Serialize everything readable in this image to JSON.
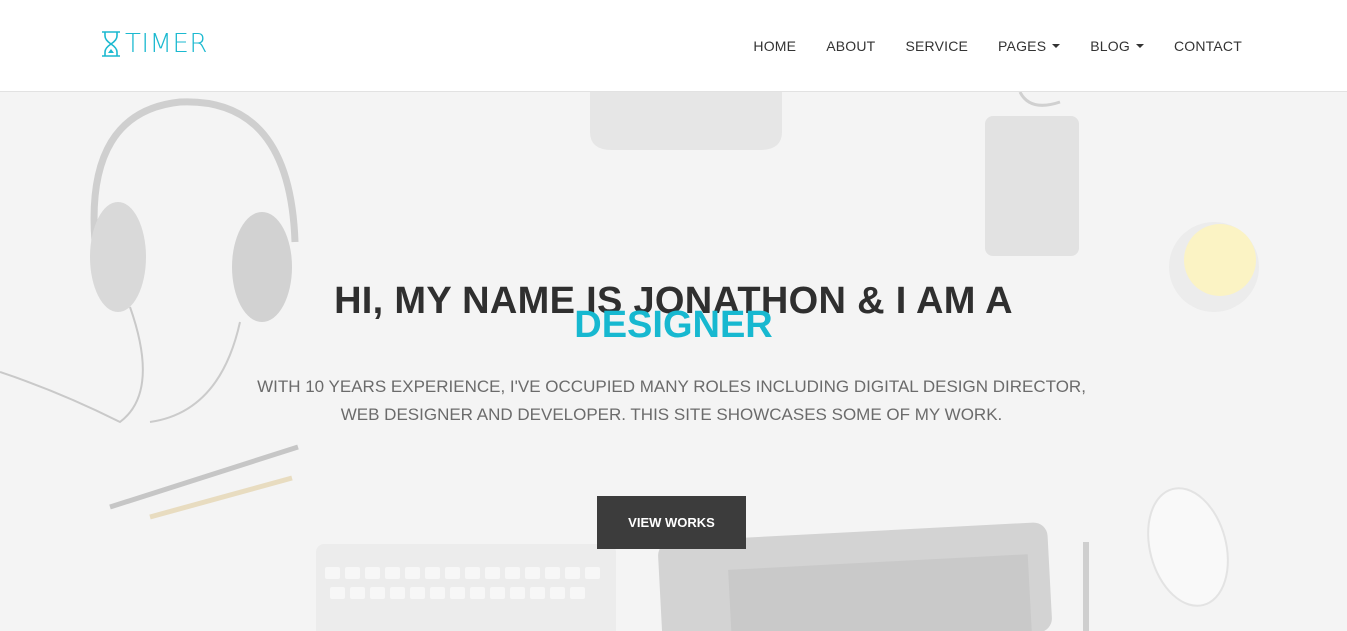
{
  "brand": {
    "name": "TIMER",
    "color": "#1bb9d0"
  },
  "nav": {
    "items": [
      {
        "label": "HOME",
        "has_dropdown": false
      },
      {
        "label": "ABOUT",
        "has_dropdown": false
      },
      {
        "label": "SERVICE",
        "has_dropdown": false
      },
      {
        "label": "PAGES",
        "has_dropdown": true
      },
      {
        "label": "BLOG",
        "has_dropdown": true
      },
      {
        "label": "CONTACT",
        "has_dropdown": false
      }
    ]
  },
  "hero": {
    "title": "HI, MY NAME IS JONATHON & I AM A",
    "highlight": "DESIGNER",
    "description_line1": "WITH 10 YEARS EXPERIENCE, I'VE OCCUPIED MANY ROLES INCLUDING DIGITAL DESIGN DIRECTOR,",
    "description_line2": "WEB DESIGNER AND DEVELOPER. THIS SITE SHOWCASES SOME OF MY WORK.",
    "cta_label": "VIEW WORKS",
    "accent_color": "#17b8d0",
    "button_color": "#3c3c3c"
  }
}
